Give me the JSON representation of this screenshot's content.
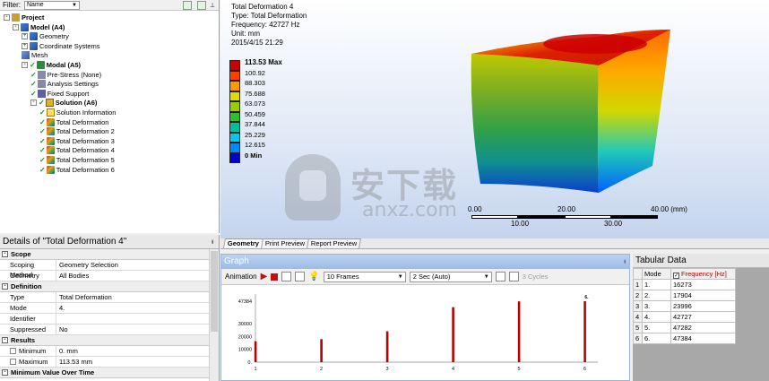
{
  "outline": {
    "filter_label": "Filter:",
    "filter_value": "Name",
    "tree": [
      {
        "label": "Project",
        "bold": true,
        "icon": "project-icon"
      },
      {
        "label": "Model (A4)",
        "bold": true,
        "icon": "model-icon"
      },
      {
        "label": "Geometry",
        "bold": false,
        "icon": "geometry-icon"
      },
      {
        "label": "Coordinate Systems",
        "bold": false,
        "icon": "coordinate-systems-icon"
      },
      {
        "label": "Mesh",
        "bold": false,
        "icon": "mesh-icon"
      },
      {
        "label": "Modal (A5)",
        "bold": true,
        "icon": "modal-icon"
      },
      {
        "label": "Pre-Stress (None)",
        "bold": false,
        "icon": "pre-stress-icon"
      },
      {
        "label": "Analysis Settings",
        "bold": false,
        "icon": "analysis-settings-icon"
      },
      {
        "label": "Fixed Support",
        "bold": false,
        "icon": "fixed-support-icon"
      },
      {
        "label": "Solution (A6)",
        "bold": true,
        "icon": "solution-icon"
      },
      {
        "label": "Solution Information",
        "bold": false,
        "icon": "solution-information-icon"
      },
      {
        "label": "Total Deformation",
        "bold": false,
        "icon": "total-deformation-icon"
      },
      {
        "label": "Total Deformation 2",
        "bold": false,
        "icon": "total-deformation-icon"
      },
      {
        "label": "Total Deformation 3",
        "bold": false,
        "icon": "total-deformation-icon"
      },
      {
        "label": "Total Deformation 4",
        "bold": false,
        "icon": "total-deformation-icon"
      },
      {
        "label": "Total Deformation 5",
        "bold": false,
        "icon": "total-deformation-icon"
      },
      {
        "label": "Total Deformation 6",
        "bold": false,
        "icon": "total-deformation-icon"
      }
    ]
  },
  "details": {
    "title": "Details of \"Total Deformation 4\"",
    "sections": [
      {
        "name": "Scope",
        "rows": [
          {
            "k": "Scoping Method",
            "v": "Geometry Selection"
          },
          {
            "k": "Geometry",
            "v": "All Bodies"
          }
        ]
      },
      {
        "name": "Definition",
        "rows": [
          {
            "k": "Type",
            "v": "Total Deformation"
          },
          {
            "k": "Mode",
            "v": "4."
          },
          {
            "k": "Identifier",
            "v": ""
          },
          {
            "k": "Suppressed",
            "v": "No"
          }
        ]
      },
      {
        "name": "Results",
        "rows": [
          {
            "k": "Minimum",
            "v": "0. mm"
          },
          {
            "k": "Maximum",
            "v": "113.53 mm"
          }
        ]
      },
      {
        "name": "Minimum Value Over Time",
        "rows": []
      }
    ]
  },
  "view": {
    "info_lines": [
      "Total Deformation 4",
      "Type: Total Deformation",
      "Frequency: 42727 Hz",
      "Unit: mm",
      "2015/4/15 21:29"
    ],
    "legend": {
      "max": "113.53 Max",
      "values": [
        "100.92",
        "88.303",
        "75.688",
        "63.073",
        "50.459",
        "37.844",
        "25.229",
        "12.615"
      ],
      "min": "0 Min",
      "colors": [
        "#cc0000",
        "#ff4000",
        "#ff9900",
        "#dddd00",
        "#99cc00",
        "#33bb33",
        "#00c0a0",
        "#00c8ee",
        "#0088ff",
        "#0000cc"
      ]
    },
    "scale": {
      "top_labels": [
        "0.00",
        "20.00",
        "40.00 (mm)"
      ],
      "bottom_labels": [
        "10.00",
        "30.00"
      ]
    },
    "watermark": {
      "text": "安下载",
      "sub": "anxz.com"
    }
  },
  "view_tabs": [
    "Geometry",
    "Print Preview",
    "Report Preview"
  ],
  "graph": {
    "title": "Graph",
    "animation_label": "Animation",
    "frames": "10 Frames",
    "duration": "2 Sec (Auto)",
    "cycles": "3 Cycles"
  },
  "chart_data": {
    "type": "bar",
    "categories": [
      "1",
      "2",
      "3",
      "4",
      "5",
      "6"
    ],
    "values": [
      16273,
      17904,
      23996,
      42727,
      47282,
      47384
    ],
    "yticks": [
      "47384",
      "30000",
      "20000",
      "10000",
      "0."
    ],
    "ylim": [
      0,
      47384
    ],
    "highlight_label": "6."
  },
  "tabular": {
    "title": "Tabular Data",
    "headers": [
      "Mode",
      "Frequency [Hz]"
    ],
    "rows": [
      {
        "n": "1",
        "mode": "1.",
        "freq": "16273"
      },
      {
        "n": "2",
        "mode": "2.",
        "freq": "17904"
      },
      {
        "n": "3",
        "mode": "3.",
        "freq": "23996"
      },
      {
        "n": "4",
        "mode": "4.",
        "freq": "42727"
      },
      {
        "n": "5",
        "mode": "5.",
        "freq": "47282"
      },
      {
        "n": "6",
        "mode": "6.",
        "freq": "47384"
      }
    ]
  }
}
